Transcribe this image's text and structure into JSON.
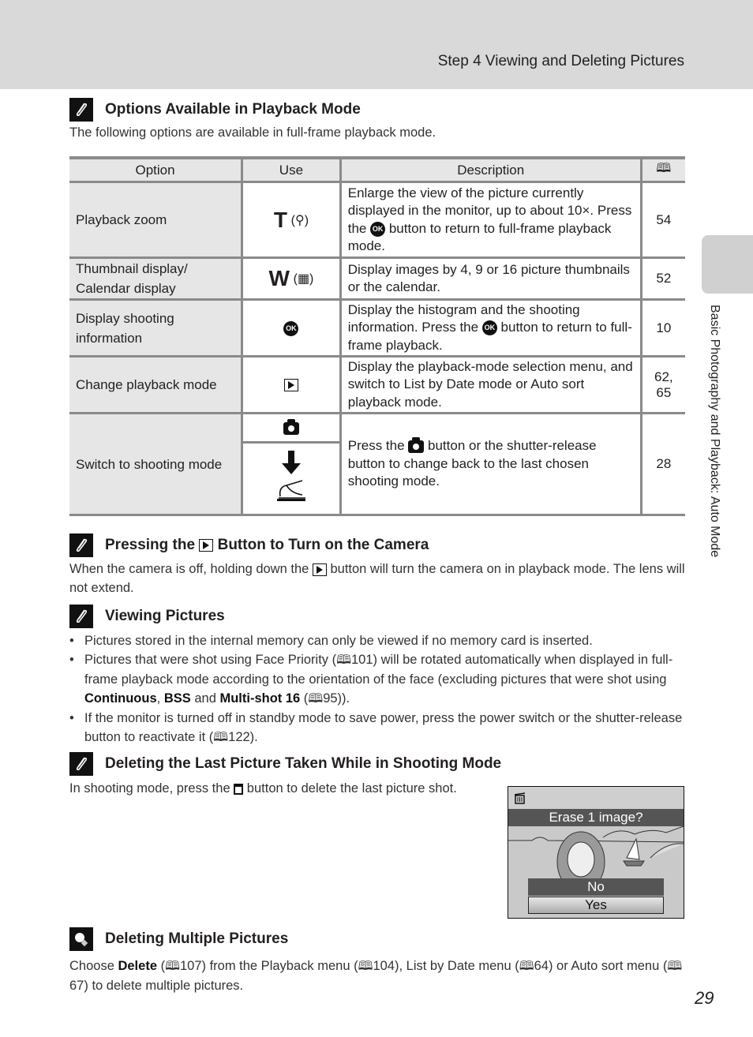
{
  "header": {
    "title": "Step 4 Viewing and Deleting Pictures"
  },
  "side_tab": {
    "label": "Basic Photography and Playback: Auto Mode"
  },
  "page_number": "29",
  "sections": {
    "options": {
      "title": "Options Available in Playback Mode",
      "intro": "The following options are available in full-frame playback mode.",
      "table": {
        "headers": [
          "Option",
          "Use",
          "Description",
          "book-ref-icon"
        ],
        "rows": [
          {
            "option": "Playback zoom",
            "use_letter": "T",
            "use_symbol": "(🔍)",
            "description_parts": [
              "Enlarge the view of the picture currently displayed in the monitor, up to about 10×. Press the ",
              " button to return to full-frame playback mode."
            ],
            "ref": "54"
          },
          {
            "option": "Thumbnail display/ Calendar display",
            "use_letter": "W",
            "use_symbol": "(▦)",
            "description": "Display images by 4, 9 or 16 picture thumbnails or the calendar.",
            "ref": "52"
          },
          {
            "option": "Display shooting information",
            "description_parts": [
              "Display the histogram and the shooting information. Press the ",
              " button to return to full-frame playback."
            ],
            "ref": "10"
          },
          {
            "option": "Change playback mode",
            "description": "Display the playback-mode selection menu, and switch to List by Date mode or Auto sort playback mode.",
            "ref": "62, 65"
          },
          {
            "option": "Switch to shooting mode",
            "description_parts": [
              "Press the ",
              " button or the shutter-release button to change back to the last chosen shooting mode."
            ],
            "ref": "28"
          }
        ],
        "ok_label": "OK"
      }
    },
    "pressing": {
      "title_parts": [
        "Pressing the ",
        " Button to Turn on the Camera"
      ],
      "text_parts": [
        "When the camera is off, holding down the ",
        " button will turn the camera on in playback mode. The lens will not extend."
      ]
    },
    "viewing": {
      "title": "Viewing Pictures",
      "bullets": {
        "b1": "Pictures stored in the internal memory can only be viewed if no memory card is inserted.",
        "b2_a": "Pictures that were shot using Face Priority (",
        "b2_ref1": "101",
        "b2_b": ") will be rotated automatically when displayed in full-frame playback mode according to the orientation of the face (excluding pictures that were shot using ",
        "b2_bold1": "Continuous",
        "b2_c": ", ",
        "b2_bold2": "BSS",
        "b2_d": " and ",
        "b2_bold3": "Multi-shot 16",
        "b2_e": " (",
        "b2_ref2": "95",
        "b2_f": ")).",
        "b3_a": "If the monitor is turned off in standby mode to save power, press the power switch or the shutter-release button to reactivate it (",
        "b3_ref": "122",
        "b3_b": ")."
      }
    },
    "deleting_last": {
      "title": "Deleting the Last Picture Taken While in Shooting Mode",
      "text_parts": [
        "In shooting mode, press the ",
        " button to delete the last picture shot."
      ],
      "lcd": {
        "prompt": "Erase 1 image?",
        "option_no": "No",
        "option_yes": "Yes"
      }
    },
    "deleting_multiple": {
      "title": "Deleting Multiple Pictures",
      "t1": "Choose ",
      "bold": "Delete",
      "t2": " (",
      "ref1": "107",
      "t3": ") from the Playback menu (",
      "ref2": "104",
      "t4": "), List by Date menu (",
      "ref3": "64",
      "t5": ") or Auto sort menu (",
      "ref4": "67",
      "t6": ") to delete multiple pictures."
    }
  },
  "book_glyph": "🕮"
}
